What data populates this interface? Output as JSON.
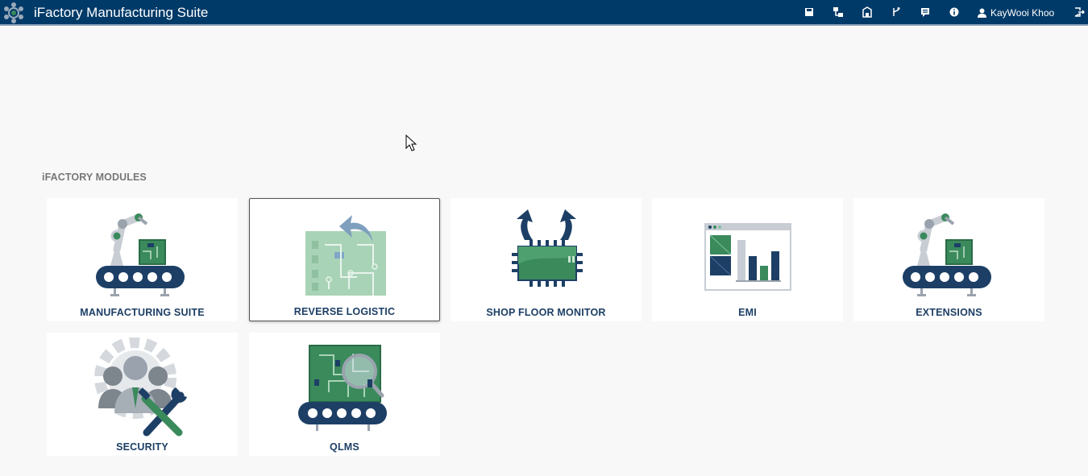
{
  "header": {
    "title": "iFactory Manufacturing Suite",
    "toolbar_icons": [
      "save-icon",
      "sitemap-icon",
      "building-icon",
      "branch-icon",
      "message-icon",
      "info-icon"
    ],
    "user": {
      "name": "KayWooi Khoo",
      "icon": "user-icon"
    },
    "logout_icon": "logout-icon",
    "colors": {
      "bar": "#003a68",
      "accent_green": "#3a8a5c"
    }
  },
  "section": {
    "title": "iFACTORY MODULES"
  },
  "modules": [
    {
      "label": "MANUFACTURING SUITE",
      "icon": "robot-arm-conveyor-icon"
    },
    {
      "label": "REVERSE LOGISTIC",
      "icon": "circuit-board-return-icon",
      "hovered": true
    },
    {
      "label": "SHOP FLOOR MONITOR",
      "icon": "chip-arrows-icon"
    },
    {
      "label": "EMI",
      "icon": "dashboard-chart-icon"
    },
    {
      "label": "EXTENSIONS",
      "icon": "robot-arm-conveyor-icon"
    },
    {
      "label": "SECURITY",
      "icon": "users-gear-tools-icon"
    },
    {
      "label": "QLMS",
      "icon": "board-inspection-icon"
    }
  ]
}
